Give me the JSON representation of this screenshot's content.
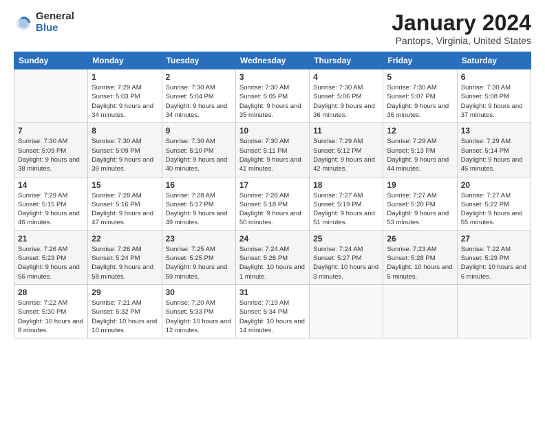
{
  "header": {
    "logo_general": "General",
    "logo_blue": "Blue",
    "title": "January 2024",
    "location": "Pantops, Virginia, United States"
  },
  "weekdays": [
    "Sunday",
    "Monday",
    "Tuesday",
    "Wednesday",
    "Thursday",
    "Friday",
    "Saturday"
  ],
  "weeks": [
    [
      {
        "day": "",
        "sunrise": "",
        "sunset": "",
        "daylight": "",
        "empty": true
      },
      {
        "day": "1",
        "sunrise": "Sunrise: 7:29 AM",
        "sunset": "Sunset: 5:03 PM",
        "daylight": "Daylight: 9 hours and 34 minutes."
      },
      {
        "day": "2",
        "sunrise": "Sunrise: 7:30 AM",
        "sunset": "Sunset: 5:04 PM",
        "daylight": "Daylight: 9 hours and 34 minutes."
      },
      {
        "day": "3",
        "sunrise": "Sunrise: 7:30 AM",
        "sunset": "Sunset: 5:05 PM",
        "daylight": "Daylight: 9 hours and 35 minutes."
      },
      {
        "day": "4",
        "sunrise": "Sunrise: 7:30 AM",
        "sunset": "Sunset: 5:06 PM",
        "daylight": "Daylight: 9 hours and 36 minutes."
      },
      {
        "day": "5",
        "sunrise": "Sunrise: 7:30 AM",
        "sunset": "Sunset: 5:07 PM",
        "daylight": "Daylight: 9 hours and 36 minutes."
      },
      {
        "day": "6",
        "sunrise": "Sunrise: 7:30 AM",
        "sunset": "Sunset: 5:08 PM",
        "daylight": "Daylight: 9 hours and 37 minutes."
      }
    ],
    [
      {
        "day": "7",
        "sunrise": "Sunrise: 7:30 AM",
        "sunset": "Sunset: 5:09 PM",
        "daylight": "Daylight: 9 hours and 38 minutes."
      },
      {
        "day": "8",
        "sunrise": "Sunrise: 7:30 AM",
        "sunset": "Sunset: 5:09 PM",
        "daylight": "Daylight: 9 hours and 39 minutes."
      },
      {
        "day": "9",
        "sunrise": "Sunrise: 7:30 AM",
        "sunset": "Sunset: 5:10 PM",
        "daylight": "Daylight: 9 hours and 40 minutes."
      },
      {
        "day": "10",
        "sunrise": "Sunrise: 7:30 AM",
        "sunset": "Sunset: 5:11 PM",
        "daylight": "Daylight: 9 hours and 41 minutes."
      },
      {
        "day": "11",
        "sunrise": "Sunrise: 7:29 AM",
        "sunset": "Sunset: 5:12 PM",
        "daylight": "Daylight: 9 hours and 42 minutes."
      },
      {
        "day": "12",
        "sunrise": "Sunrise: 7:29 AM",
        "sunset": "Sunset: 5:13 PM",
        "daylight": "Daylight: 9 hours and 44 minutes."
      },
      {
        "day": "13",
        "sunrise": "Sunrise: 7:29 AM",
        "sunset": "Sunset: 5:14 PM",
        "daylight": "Daylight: 9 hours and 45 minutes."
      }
    ],
    [
      {
        "day": "14",
        "sunrise": "Sunrise: 7:29 AM",
        "sunset": "Sunset: 5:15 PM",
        "daylight": "Daylight: 9 hours and 46 minutes."
      },
      {
        "day": "15",
        "sunrise": "Sunrise: 7:28 AM",
        "sunset": "Sunset: 5:16 PM",
        "daylight": "Daylight: 9 hours and 47 minutes."
      },
      {
        "day": "16",
        "sunrise": "Sunrise: 7:28 AM",
        "sunset": "Sunset: 5:17 PM",
        "daylight": "Daylight: 9 hours and 49 minutes."
      },
      {
        "day": "17",
        "sunrise": "Sunrise: 7:28 AM",
        "sunset": "Sunset: 5:18 PM",
        "daylight": "Daylight: 9 hours and 50 minutes."
      },
      {
        "day": "18",
        "sunrise": "Sunrise: 7:27 AM",
        "sunset": "Sunset: 5:19 PM",
        "daylight": "Daylight: 9 hours and 51 minutes."
      },
      {
        "day": "19",
        "sunrise": "Sunrise: 7:27 AM",
        "sunset": "Sunset: 5:20 PM",
        "daylight": "Daylight: 9 hours and 53 minutes."
      },
      {
        "day": "20",
        "sunrise": "Sunrise: 7:27 AM",
        "sunset": "Sunset: 5:22 PM",
        "daylight": "Daylight: 9 hours and 55 minutes."
      }
    ],
    [
      {
        "day": "21",
        "sunrise": "Sunrise: 7:26 AM",
        "sunset": "Sunset: 5:23 PM",
        "daylight": "Daylight: 9 hours and 56 minutes."
      },
      {
        "day": "22",
        "sunrise": "Sunrise: 7:26 AM",
        "sunset": "Sunset: 5:24 PM",
        "daylight": "Daylight: 9 hours and 58 minutes."
      },
      {
        "day": "23",
        "sunrise": "Sunrise: 7:25 AM",
        "sunset": "Sunset: 5:25 PM",
        "daylight": "Daylight: 9 hours and 59 minutes."
      },
      {
        "day": "24",
        "sunrise": "Sunrise: 7:24 AM",
        "sunset": "Sunset: 5:26 PM",
        "daylight": "Daylight: 10 hours and 1 minute."
      },
      {
        "day": "25",
        "sunrise": "Sunrise: 7:24 AM",
        "sunset": "Sunset: 5:27 PM",
        "daylight": "Daylight: 10 hours and 3 minutes."
      },
      {
        "day": "26",
        "sunrise": "Sunrise: 7:23 AM",
        "sunset": "Sunset: 5:28 PM",
        "daylight": "Daylight: 10 hours and 5 minutes."
      },
      {
        "day": "27",
        "sunrise": "Sunrise: 7:22 AM",
        "sunset": "Sunset: 5:29 PM",
        "daylight": "Daylight: 10 hours and 6 minutes."
      }
    ],
    [
      {
        "day": "28",
        "sunrise": "Sunrise: 7:22 AM",
        "sunset": "Sunset: 5:30 PM",
        "daylight": "Daylight: 10 hours and 8 minutes."
      },
      {
        "day": "29",
        "sunrise": "Sunrise: 7:21 AM",
        "sunset": "Sunset: 5:32 PM",
        "daylight": "Daylight: 10 hours and 10 minutes."
      },
      {
        "day": "30",
        "sunrise": "Sunrise: 7:20 AM",
        "sunset": "Sunset: 5:33 PM",
        "daylight": "Daylight: 10 hours and 12 minutes."
      },
      {
        "day": "31",
        "sunrise": "Sunrise: 7:19 AM",
        "sunset": "Sunset: 5:34 PM",
        "daylight": "Daylight: 10 hours and 14 minutes."
      },
      {
        "day": "",
        "sunrise": "",
        "sunset": "",
        "daylight": "",
        "empty": true
      },
      {
        "day": "",
        "sunrise": "",
        "sunset": "",
        "daylight": "",
        "empty": true
      },
      {
        "day": "",
        "sunrise": "",
        "sunset": "",
        "daylight": "",
        "empty": true
      }
    ]
  ]
}
